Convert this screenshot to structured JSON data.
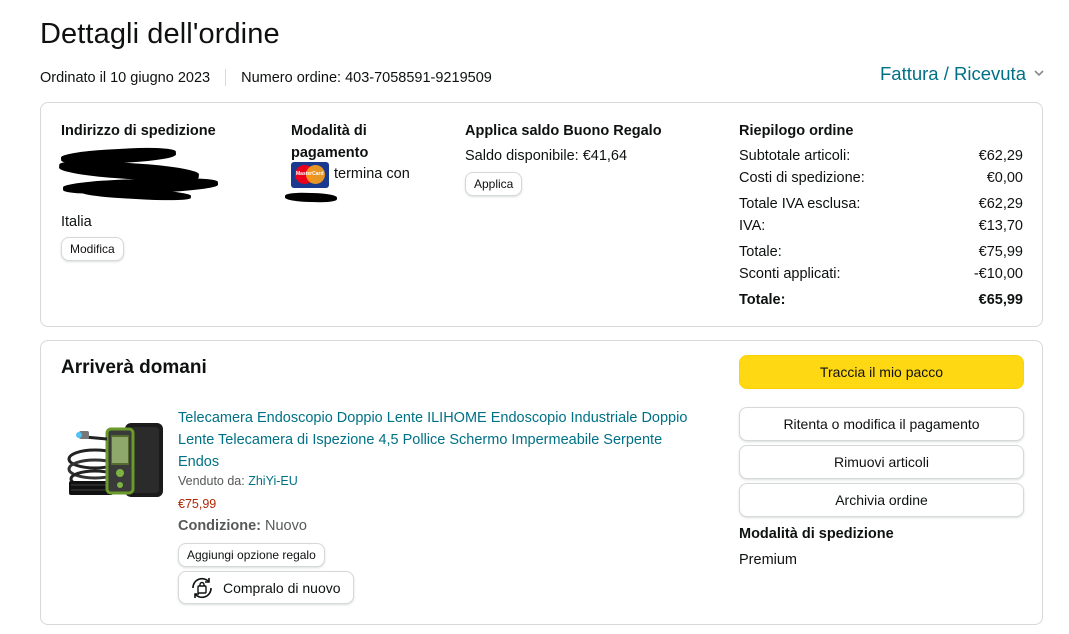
{
  "page": {
    "title": "Dettagli dell'ordine",
    "ordered_on": "Ordinato il 10 giugno 2023",
    "order_number": "Numero ordine: 403-7058591-9219509",
    "invoice_link": "Fattura / Ricevuta",
    "invoice_chevron_icon": "chevron-down-icon"
  },
  "shipping_address": {
    "title": "Indirizzo di spedizione",
    "country": "Italia",
    "edit_button": "Modifica"
  },
  "payment": {
    "title_line1": "Modalità di",
    "title_line2": "pagamento",
    "card_icon": "mastercard-icon",
    "card_logo_text": "MasterCard",
    "ends_with": "termina con"
  },
  "gift_card": {
    "title": "Applica saldo Buono Regalo",
    "balance": "Saldo disponibile: €41,64",
    "apply_button": "Applica"
  },
  "summary": {
    "title": "Riepilogo ordine",
    "rows": [
      {
        "label": "Subtotale articoli:",
        "value": "€62,29"
      },
      {
        "label": "Costi di spedizione:",
        "value": "€0,00"
      },
      {
        "label": "Totale IVA esclusa:",
        "value": "€62,29"
      },
      {
        "label": "IVA:",
        "value": "€13,70"
      },
      {
        "label": "Totale:",
        "value": "€75,99"
      },
      {
        "label": "Sconti applicati:",
        "value": "-€10,00"
      },
      {
        "label": "Totale:",
        "value": "€65,99"
      }
    ]
  },
  "shipment": {
    "arrival_title": "Arriverà domani",
    "product": {
      "title": "Telecamera Endoscopio Doppio Lente ILIHOME Endoscopio Industriale Doppio Lente Telecamera di Ispezione 4,5 Pollice Schermo Impermeabile Serpente Endos",
      "sold_by_label": "Venduto da:",
      "seller": "ZhiYi-EU",
      "price": "€75,99",
      "condition_label": "Condizione:",
      "condition_value": "Nuovo",
      "gift_button": "Aggiungi opzione regalo",
      "buy_again_button": "Compralo di nuovo",
      "buy_again_icon": "buy-again-icon"
    },
    "actions": {
      "track": "Traccia il mio pacco",
      "retry_payment": "Ritenta o modifica il pagamento",
      "remove_items": "Rimuovi articoli",
      "archive": "Archivia ordine"
    },
    "shipping_method_title": "Modalità di spedizione",
    "shipping_method_value": "Premium"
  },
  "colors": {
    "link": "#007185",
    "price": "#B12704",
    "primary_button": "#FFD814",
    "border": "#D5D9D9"
  }
}
